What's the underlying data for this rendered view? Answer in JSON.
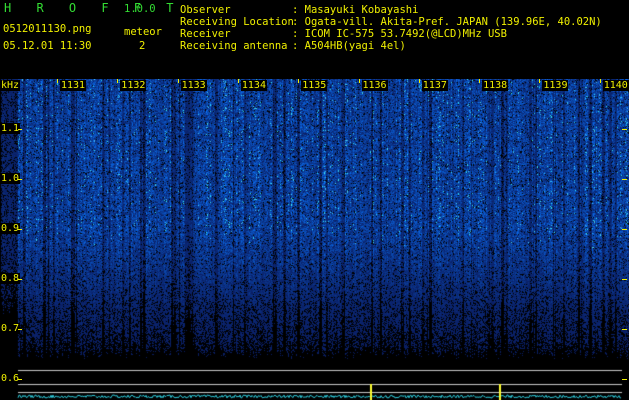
{
  "header": {
    "app_name": "H R O F F T",
    "app_version": "1.0.0",
    "filename": "0512011130.png",
    "datetime": "05.12.01 11:30",
    "meteor_label": "meteor",
    "meteor_count": "2",
    "fields": [
      {
        "key": "Observer",
        "value": ": Masayuki Kobayashi"
      },
      {
        "key": "Receiving Location",
        "value": ": Ogata-vill. Akita-Pref. JAPAN (139.96E, 40.02N)"
      },
      {
        "key": "Receiver",
        "value": ": ICOM IC-575 53.7492(@LCD)MHz USB"
      },
      {
        "key": "Receiving antenna",
        "value": ": A504HB(yagi 4el)"
      }
    ]
  },
  "spectrogram": {
    "unit_label": "kHz",
    "freq_ticks": [
      {
        "value": 1.1,
        "label": "1.1"
      },
      {
        "value": 1.0,
        "label": "1.0"
      },
      {
        "value": 0.9,
        "label": "0.9"
      },
      {
        "value": 0.8,
        "label": "0.8"
      },
      {
        "value": 0.7,
        "label": "0.7"
      },
      {
        "value": 0.6,
        "label": "0.6"
      }
    ],
    "time_labels": [
      "1131",
      "1132",
      "1133",
      "1134",
      "1135",
      "1136",
      "1137",
      "1138",
      "1139",
      "1140"
    ],
    "colors": {
      "background": "#000000",
      "text": "#f0f000",
      "noise_low": "#0a1a70",
      "noise_high": "#30c0ff",
      "marker_line": "#c8c8c8",
      "power_trace": "#30d0e0",
      "meteor_spike": "#ffff30"
    }
  }
}
